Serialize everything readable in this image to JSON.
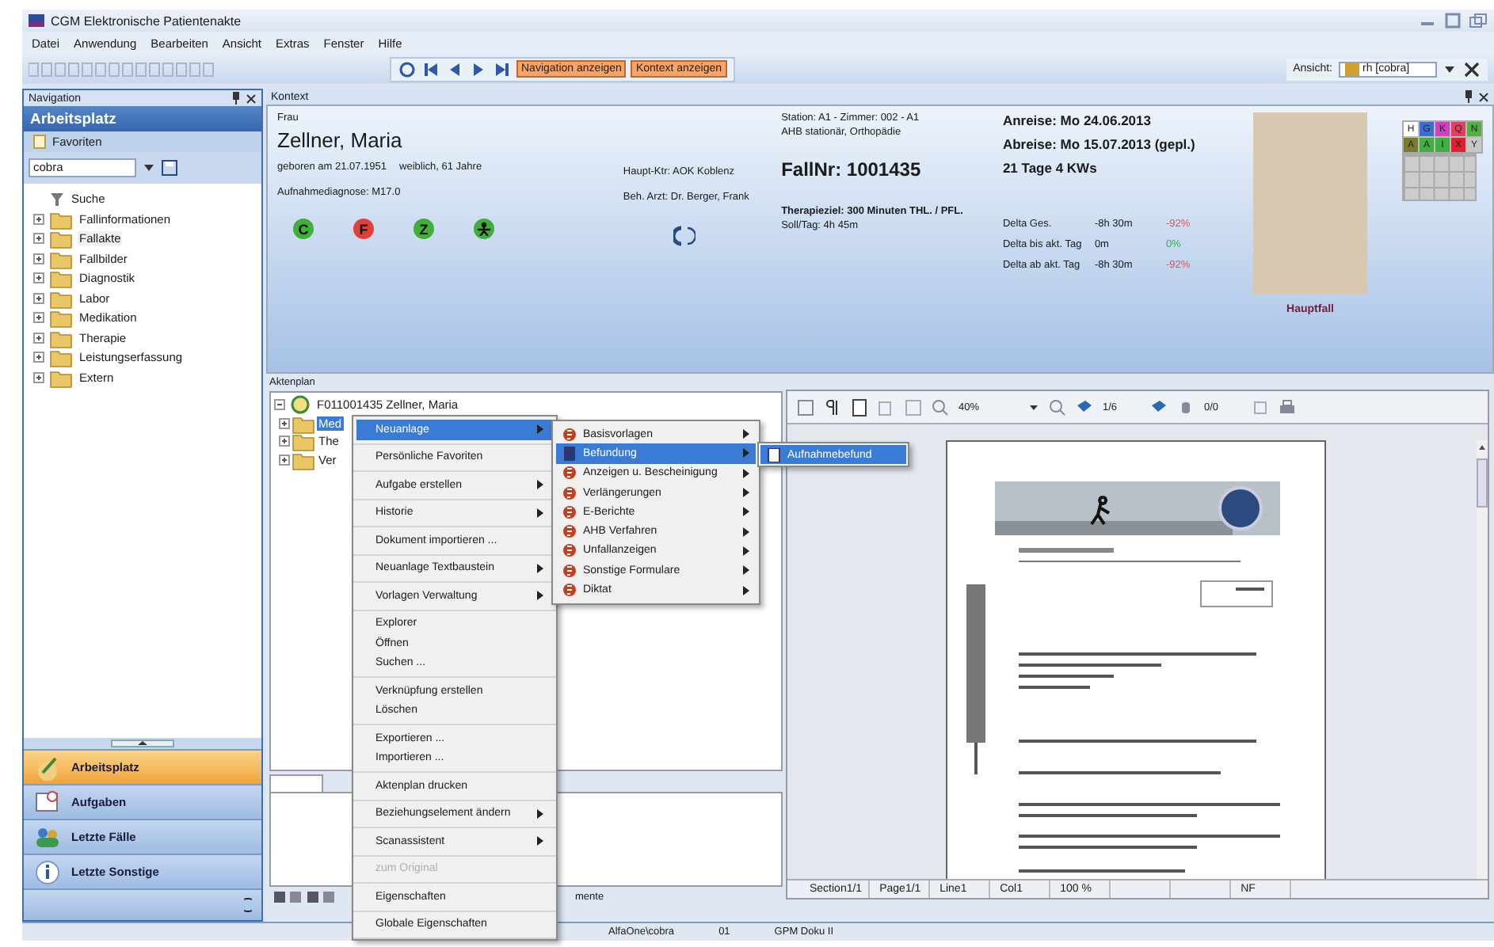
{
  "window": {
    "title": "CGM Elektronische Patientenakte"
  },
  "menu_bar": [
    "Datei",
    "Anwendung",
    "Bearbeiten",
    "Ansicht",
    "Extras",
    "Fenster",
    "Hilfe"
  ],
  "toolbar": {
    "toggles": [
      {
        "label": "Navigation anzeigen",
        "on": true
      },
      {
        "label": "Kontext anzeigen",
        "on": true
      }
    ],
    "view_label": "Ansicht:",
    "view_value": "rh [cobra]"
  },
  "navigation": {
    "title": "Navigation",
    "header": "Arbeitsplatz",
    "favorites": "Favoriten",
    "combo_value": "cobra",
    "tree": [
      {
        "label": "Suche",
        "kind": "search",
        "selected": false
      },
      {
        "label": "Fallinformationen",
        "kind": "folder",
        "selected": false
      },
      {
        "label": "Fallakte",
        "kind": "folder",
        "selected": true
      },
      {
        "label": "Fallbilder",
        "kind": "folder",
        "selected": false
      },
      {
        "label": "Diagnostik",
        "kind": "folder",
        "selected": false
      },
      {
        "label": "Labor",
        "kind": "folder",
        "selected": false
      },
      {
        "label": "Medikation",
        "kind": "folder",
        "selected": false
      },
      {
        "label": "Therapie",
        "kind": "folder",
        "selected": false
      },
      {
        "label": "Leistungserfassung",
        "kind": "folder",
        "selected": false
      },
      {
        "label": "Extern",
        "kind": "folder",
        "selected": false
      }
    ],
    "buttons": [
      {
        "label": "Arbeitsplatz",
        "selected": true
      },
      {
        "label": "Aufgaben",
        "selected": false
      },
      {
        "label": "Letzte Fälle",
        "selected": false
      },
      {
        "label": "Letzte Sonstige",
        "selected": false
      }
    ]
  },
  "context": {
    "title": "Kontext",
    "salutation": "Frau",
    "name": "Zellner, Maria",
    "born": "geboren am 21.07.1951",
    "sex_age": "weiblich, 61 Jahre",
    "diagnosis": "Aufnahmediagnose: M17.0",
    "insurer": "Haupt-Ktr: AOK Koblenz",
    "doctor": "Beh. Arzt: Dr. Berger, Frank",
    "status_icons": [
      {
        "kind": "letter",
        "text": "C",
        "color": "#3fae3a"
      },
      {
        "kind": "letter",
        "text": "F",
        "color": "#e0403a"
      },
      {
        "kind": "letter",
        "text": "Z",
        "color": "#3fae3a"
      },
      {
        "kind": "person",
        "color": "#3fae3a"
      }
    ],
    "station": "Station: A1 - Zimmer: 002 - A1",
    "stay_type": "AHB stationär, Orthopädie",
    "case_number": "FallNr: 1001435",
    "therapy_goal": "Therapieziel: 300 Minuten THL. / PFL.",
    "target_per_day": "Soll/Tag: 4h 45m",
    "arrival": "Anreise: Mo 24.06.2013",
    "departure": "Abreise: Mo 15.07.2013 (gepl.)",
    "duration": "21 Tage 4 KWs",
    "deltas": [
      {
        "label": "Delta Ges.",
        "time": "-8h 30m",
        "percent": "-92%",
        "color": "#e05050"
      },
      {
        "label": "Delta bis akt. Tag",
        "time": "0m",
        "percent": "0%",
        "color": "#30b050"
      },
      {
        "label": "Delta ab akt. Tag",
        "time": "-8h 30m",
        "percent": "-92%",
        "color": "#e05050"
      }
    ],
    "photo_caption": "Hauptfall",
    "tags": [
      {
        "text": "H",
        "color": "#ffffff"
      },
      {
        "text": "G",
        "color": "#3a6fd0"
      },
      {
        "text": "K",
        "color": "#d040c0"
      },
      {
        "text": "Q",
        "color": "#e04060"
      },
      {
        "text": "N",
        "color": "#50b040"
      },
      {
        "text": "A",
        "color": "#7a7a30"
      },
      {
        "text": "A",
        "color": "#40b040"
      },
      {
        "text": "I",
        "color": "#40b040"
      },
      {
        "text": "X",
        "color": "#e02030"
      },
      {
        "text": "Y",
        "color": "#c8c8c8"
      }
    ]
  },
  "file_plan": {
    "title": "Aktenplan",
    "root": "F011001435 Zellner, Maria",
    "children": [
      {
        "label": "Med",
        "selected": true
      },
      {
        "label": "The",
        "selected": false
      },
      {
        "label": "Ver",
        "selected": false
      }
    ],
    "bottom_text": "mente"
  },
  "context_menu": {
    "groups": [
      {
        "items": [
          {
            "label": "Neuanlage",
            "selected": true,
            "has_submenu": true,
            "disabled": false
          }
        ]
      },
      {
        "items": [
          {
            "label": "Persönliche Favoriten",
            "selected": false,
            "has_submenu": false,
            "disabled": false
          }
        ]
      },
      {
        "items": [
          {
            "label": "Aufgabe erstellen",
            "selected": false,
            "has_submenu": true,
            "disabled": false
          }
        ]
      },
      {
        "items": [
          {
            "label": "Historie",
            "selected": false,
            "has_submenu": true,
            "disabled": false
          }
        ]
      },
      {
        "items": [
          {
            "label": "Dokument importieren ...",
            "selected": false,
            "has_submenu": false,
            "disabled": false
          }
        ]
      },
      {
        "items": [
          {
            "label": "Neuanlage Textbaustein",
            "selected": false,
            "has_submenu": true,
            "disabled": false
          }
        ]
      },
      {
        "items": [
          {
            "label": "Vorlagen Verwaltung",
            "selected": false,
            "has_submenu": true,
            "disabled": false
          }
        ]
      },
      {
        "items": [
          {
            "label": "Explorer",
            "selected": false,
            "has_submenu": false,
            "disabled": false
          },
          {
            "label": "Öffnen",
            "selected": false,
            "has_submenu": false,
            "disabled": false
          },
          {
            "label": "Suchen ...",
            "selected": false,
            "has_submenu": false,
            "disabled": false
          }
        ]
      },
      {
        "items": [
          {
            "label": "Verknüpfung erstellen",
            "selected": false,
            "has_submenu": false,
            "disabled": false
          },
          {
            "label": "Löschen",
            "selected": false,
            "has_submenu": false,
            "disabled": false
          }
        ]
      },
      {
        "items": [
          {
            "label": "Exportieren ...",
            "selected": false,
            "has_submenu": false,
            "disabled": false
          },
          {
            "label": "Importieren ...",
            "selected": false,
            "has_submenu": false,
            "disabled": false
          }
        ]
      },
      {
        "items": [
          {
            "label": "Aktenplan drucken",
            "selected": false,
            "has_submenu": false,
            "disabled": false
          }
        ]
      },
      {
        "items": [
          {
            "label": "Beziehungselement ändern",
            "selected": false,
            "has_submenu": true,
            "disabled": false
          }
        ]
      },
      {
        "items": [
          {
            "label": "Scanassistent",
            "selected": false,
            "has_submenu": true,
            "disabled": false
          }
        ]
      },
      {
        "items": [
          {
            "label": "zum Original",
            "selected": false,
            "has_submenu": false,
            "disabled": true
          }
        ]
      },
      {
        "items": [
          {
            "label": "Eigenschaften",
            "selected": false,
            "has_submenu": false,
            "disabled": false
          }
        ]
      },
      {
        "items": [
          {
            "label": "Globale Eigenschaften",
            "selected": false,
            "has_submenu": false,
            "disabled": false
          }
        ]
      }
    ]
  },
  "submenu": [
    {
      "label": "Basisvorlagen",
      "selected": false
    },
    {
      "label": "Befundung",
      "selected": true
    },
    {
      "label": "Anzeigen u. Bescheinigung",
      "selected": false
    },
    {
      "label": "Verlängerungen",
      "selected": false
    },
    {
      "label": "E-Berichte",
      "selected": false
    },
    {
      "label": "AHB Verfahren",
      "selected": false
    },
    {
      "label": "Unfallanzeigen",
      "selected": false
    },
    {
      "label": "Sonstige Formulare",
      "selected": false
    },
    {
      "label": "Diktat",
      "selected": false
    }
  ],
  "submenu_2": [
    {
      "label": "Aufnahmebefund",
      "selected": true
    }
  ],
  "viewer": {
    "zoom": "40%",
    "page": "1/6",
    "marks": "0/0",
    "status": [
      "Section1/1",
      "Page1/1",
      "Line1",
      "Col1",
      "100 %",
      "NF"
    ]
  },
  "status_bar": [
    "AlfaOne\\cobra",
    "01",
    "GPM Doku II"
  ]
}
